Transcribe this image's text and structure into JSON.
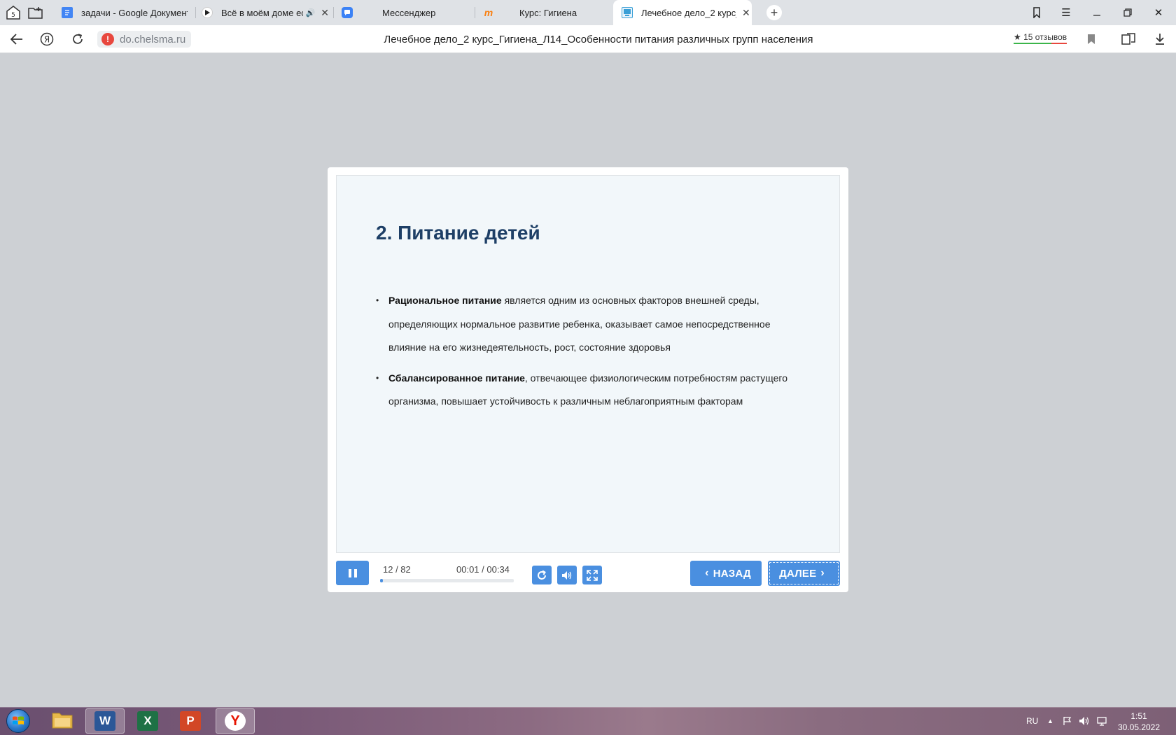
{
  "tabs": [
    {
      "label": "задачи - Google Документ",
      "favicon": "google-docs-icon",
      "color": "#4285f4"
    },
    {
      "label": "Всё в моём доме ест",
      "favicon": "play-icon",
      "color": "#ffffff"
    },
    {
      "label": "Мессенджер",
      "favicon": "messenger-icon",
      "color": "#3b82f6"
    },
    {
      "label": "Курс: Гигиена",
      "favicon": "moodle-icon",
      "color": "#f98012"
    },
    {
      "label": "Лечебное дело_2 курс_",
      "favicon": "courselab-icon",
      "color": "#3a9fd6"
    }
  ],
  "address": {
    "url": "do.chelsma.ru",
    "page_title": "Лечебное дело_2 курс_Гигиена_Л14_Особенности питания различных групп населения",
    "reviews": "15 отзывов"
  },
  "slide": {
    "title": "2. Питание детей",
    "bullets": [
      {
        "bold": "Рациональное питание",
        "text": " является одним из основных факторов внешней среды, определяющих нормальное развитие ребенка, оказывает самое непосредственное влияние на его жизнедеятельность, рост, состояние здоровья"
      },
      {
        "bold": "Сбалансированное питание",
        "text": ", отвечающее физиологическим потребностям растущего организма, повышает устойчивость к различным неблагоприятным факторам"
      }
    ]
  },
  "player": {
    "slide_counter": "12 / 82",
    "time": "00:01 / 00:34",
    "progress_fraction": 0.02,
    "back_label": "НАЗАД",
    "next_label": "ДАЛЕЕ",
    "accent": "#4a8fe0"
  },
  "taskbar": {
    "apps": [
      {
        "name": "explorer",
        "glyph": "",
        "color": "#e8b94a"
      },
      {
        "name": "word",
        "glyph": "W",
        "color": "#2b5797"
      },
      {
        "name": "excel",
        "glyph": "X",
        "color": "#1e7145"
      },
      {
        "name": "powerpoint",
        "glyph": "P",
        "color": "#d24726"
      },
      {
        "name": "yandex-browser",
        "glyph": "Y",
        "color": "#e61400"
      }
    ],
    "lang": "RU",
    "time": "1:51",
    "date": "30.05.2022"
  }
}
